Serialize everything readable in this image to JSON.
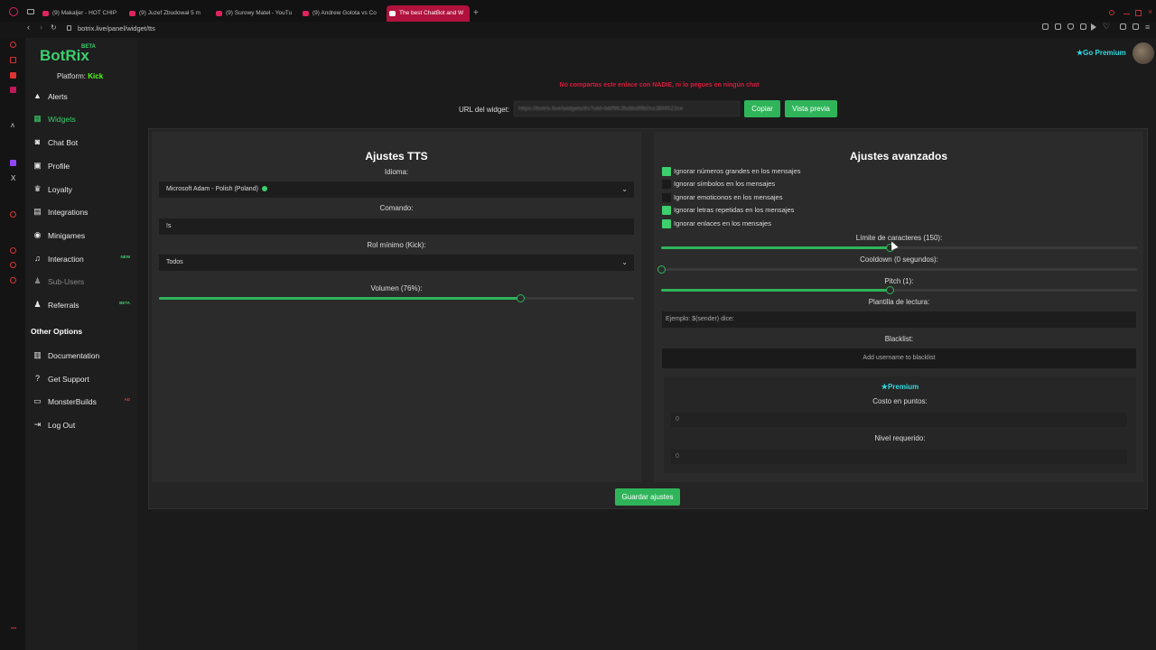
{
  "browser": {
    "tabs": [
      {
        "label": "(9) Makaljer - HOT CHIP"
      },
      {
        "label": "(9) Juzef Zbudował 5 m"
      },
      {
        "label": "(9) Surowy Mateł - YouTu"
      },
      {
        "label": "(9) Andrew Golota vs Co"
      },
      {
        "label": "The best ChatBot and W"
      }
    ],
    "new_tab": "+",
    "url": "botrix.live/panel/widget/tts"
  },
  "brand": {
    "name": "BotRix",
    "beta": "BETA",
    "platform_label": "Platform:",
    "platform_value": "Kick",
    "accent": "#3ccf6e",
    "kick_color": "#53fc18",
    "premium_color": "#2fd9e0",
    "warning_color": "#d81b3c"
  },
  "sidebar": {
    "items": [
      {
        "label": "Alerts",
        "icon": "warning-icon"
      },
      {
        "label": "Widgets",
        "icon": "widgets-icon",
        "active": true
      },
      {
        "label": "Chat Bot",
        "icon": "robot-icon"
      },
      {
        "label": "Profile",
        "icon": "profile-icon"
      },
      {
        "label": "Loyalty",
        "icon": "trophy-icon"
      },
      {
        "label": "Integrations",
        "icon": "integrations-icon"
      },
      {
        "label": "Minigames",
        "icon": "gamepad-icon"
      },
      {
        "label": "Interaction",
        "icon": "music-icon",
        "badge": "NEW"
      },
      {
        "label": "Sub-Users",
        "icon": "users-icon"
      },
      {
        "label": "Referrals",
        "icon": "referrals-icon",
        "badge": "BETA"
      }
    ],
    "other_title": "Other Options",
    "other_items": [
      {
        "label": "Documentation",
        "icon": "book-icon"
      },
      {
        "label": "Get Support",
        "icon": "help-icon"
      },
      {
        "label": "MonsterBuilds",
        "icon": "monitor-icon"
      },
      {
        "label": "Log Out",
        "icon": "logout-icon"
      }
    ]
  },
  "header": {
    "go_premium": "Go Premium"
  },
  "widget": {
    "warning": "No compartas este enlace con NADIE, ni lo pegues en ningún chat",
    "url_label": "URL del widget:",
    "url_value": "https://botrix.live/widgets/tts?uid=b6f9fc3bd8c89b0cc36f4522ce",
    "copy_button": "Copiar",
    "preview_button": "Vista previa"
  },
  "tts": {
    "title": "Ajustes TTS",
    "language_label": "Idioma:",
    "language_value": "Microsoft Adam - Polish (Poland)",
    "command_label": "Comando:",
    "command_value": "!s",
    "role_label": "Rol mínimo (Kick):",
    "role_value": "Todos",
    "volume_label": "Volumen (76%):",
    "volume_fraction": 0.76
  },
  "advanced": {
    "title": "Ajustes avanzados",
    "checks": [
      {
        "label": "Ignorar números grandes en los mensajes",
        "checked": true
      },
      {
        "label": "Ignorar símbolos en los mensajes",
        "checked": false
      },
      {
        "label": "Ignorar emoticonos en los mensajes",
        "checked": false
      },
      {
        "label": "Ignorar letras repetidas en los mensajes",
        "checked": true
      },
      {
        "label": "Ignorar enlaces en los mensajes",
        "checked": true
      }
    ],
    "char_limit_label": "Límite de caracteres (150):",
    "char_limit_fraction": 0.48,
    "cooldown_label": "Cooldown (0 segundos):",
    "cooldown_fraction": 0,
    "pitch_label": "Pitch (1):",
    "pitch_fraction": 0.48,
    "template_label": "Plantilla de lectura:",
    "template_placeholder": "Ejemplo: $(sender) dice:",
    "blacklist_label": "Blacklist:",
    "blacklist_placeholder": "Add username to blacklist",
    "premium_label": "Premium",
    "cost_label": "Costo en puntos:",
    "cost_value": "0",
    "level_label": "Nivel requerido:",
    "level_value": "0"
  },
  "footer": {
    "save_button": "Guardar ajustes"
  }
}
